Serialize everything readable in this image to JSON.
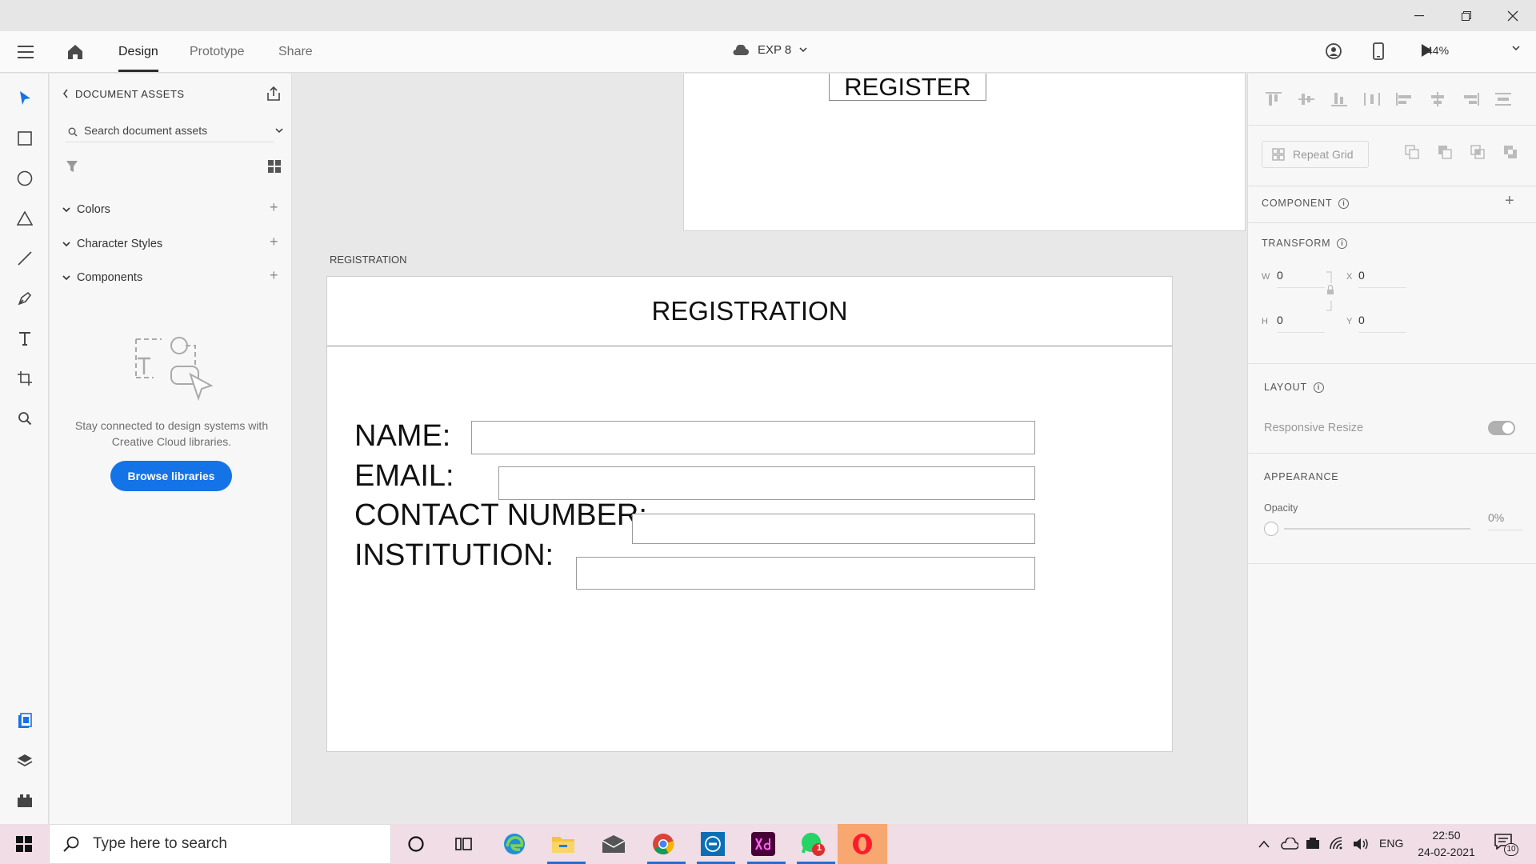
{
  "app": {
    "tabs": [
      {
        "label": "Design"
      },
      {
        "label": "Prototype"
      },
      {
        "label": "Share"
      }
    ],
    "document_title": "EXP 8",
    "zoom": "44%"
  },
  "assets_panel": {
    "title": "DOCUMENT ASSETS",
    "search_placeholder": "Search document assets",
    "sections": [
      {
        "label": "Colors"
      },
      {
        "label": "Character Styles"
      },
      {
        "label": "Components"
      }
    ],
    "empty_text": "Stay connected to design systems with Creative Cloud libraries.",
    "browse_button": "Browse libraries"
  },
  "canvas": {
    "top_artboard_button": "REGISTER",
    "artboard_label": "REGISTRATION",
    "artboard_header": "REGISTRATION",
    "form_fields": [
      {
        "label": "NAME:"
      },
      {
        "label": "EMAIL:"
      },
      {
        "label": "CONTACT NUMBER:"
      },
      {
        "label": "INSTITUTION:"
      }
    ]
  },
  "inspector": {
    "repeat_grid": "Repeat Grid",
    "component_title": "COMPONENT",
    "transform_title": "TRANSFORM",
    "w_label": "W",
    "w_value": "0",
    "x_label": "X",
    "x_value": "0",
    "h_label": "H",
    "h_value": "0",
    "y_label": "Y",
    "y_value": "0",
    "layout_title": "LAYOUT",
    "responsive_resize": "Responsive Resize",
    "appearance_title": "APPEARANCE",
    "opacity_label": "Opacity",
    "opacity_value": "0%"
  },
  "taskbar": {
    "search_placeholder": "Type here to search",
    "language": "ENG",
    "time": "22:50",
    "date": "24-02-2021",
    "notification_count": "10",
    "whatsapp_badge": "1"
  },
  "colors": {
    "accent": "#1473e6",
    "adobe_xd": "#470137",
    "opera": "#ff1b2d"
  }
}
